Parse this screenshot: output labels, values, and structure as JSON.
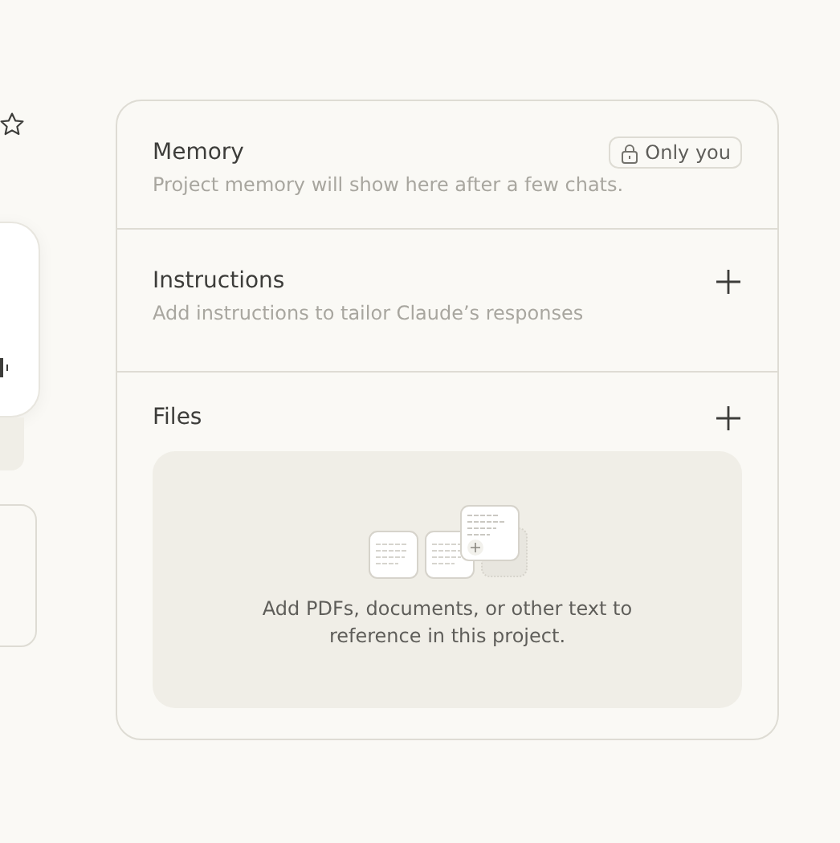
{
  "memory": {
    "title": "Memory",
    "description": "Project memory will show here after a few chats.",
    "badge": "Only you"
  },
  "instructions": {
    "title": "Instructions",
    "description": "Add instructions to tailor Claude’s responses"
  },
  "files": {
    "title": "Files",
    "empty_text": "Add PDFs, documents, or other text to reference in this project."
  }
}
